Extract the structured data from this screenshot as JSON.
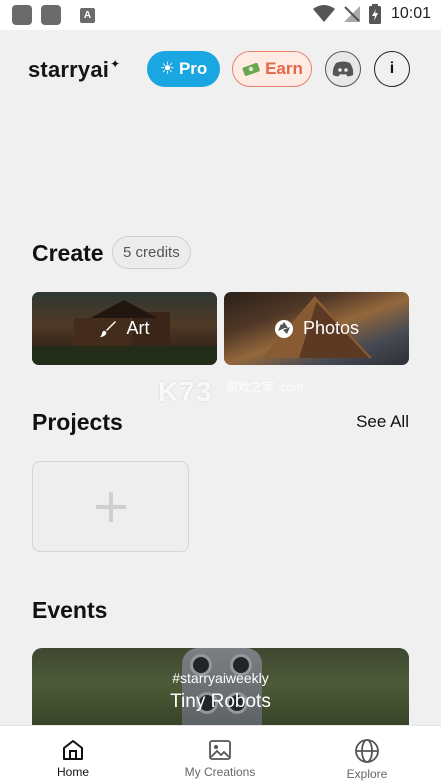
{
  "status_bar": {
    "time": "10:01"
  },
  "header": {
    "logo": "starryai",
    "pro_label": "Pro",
    "earn_label": "Earn"
  },
  "create": {
    "title": "Create",
    "credits": "5 credits",
    "cards": [
      {
        "label": "Art",
        "icon": "brush-icon"
      },
      {
        "label": "Photos",
        "icon": "aperture-icon"
      }
    ]
  },
  "watermark": {
    "text": "K73",
    "sub": "游戏之家 .com"
  },
  "projects": {
    "title": "Projects",
    "see_all": "See All"
  },
  "events": {
    "title": "Events",
    "event": {
      "tag": "#starryaiweekly",
      "title": "Tiny Robots"
    }
  },
  "nav": {
    "items": [
      {
        "label": "Home",
        "icon": "home-icon",
        "active": true
      },
      {
        "label": "My Creations",
        "icon": "image-icon",
        "active": false
      },
      {
        "label": "Explore",
        "icon": "globe-icon",
        "active": false
      }
    ]
  },
  "colors": {
    "pro": "#1aa6e0",
    "earn": "#e1694b",
    "background": "#f0f0f0"
  }
}
